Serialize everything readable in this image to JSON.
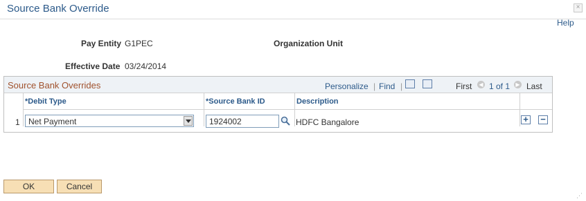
{
  "window": {
    "title": "Source Bank Override",
    "close_glyph": "×"
  },
  "help_link": "Help",
  "header": {
    "pay_entity_label": "Pay Entity",
    "pay_entity_value": "G1PEC",
    "org_unit_label": "Organization Unit",
    "effective_date_label": "Effective Date",
    "effective_date_value": "03/24/2014"
  },
  "grid": {
    "title": "Source Bank Overrides",
    "toolbar": {
      "personalize": "Personalize",
      "separator": "|",
      "find": "Find",
      "first": "First",
      "range": "1 of 1",
      "last": "Last"
    },
    "columns": [
      "*Debit Type",
      "*Source Bank ID",
      "Description"
    ],
    "rows": [
      {
        "num": "1",
        "debit_type": "Net Payment",
        "source_bank_id": "1924002",
        "description": "HDFC Bangalore"
      }
    ],
    "row_actions": {
      "add": "+",
      "delete": "−"
    }
  },
  "buttons": {
    "ok": "OK",
    "cancel": "Cancel"
  },
  "colors": {
    "title": "#2c5a8a",
    "grid_title": "#a0522d",
    "button_bg": "#f7dfb5"
  },
  "icons": [
    "close-icon",
    "view-all-icon",
    "download-icon",
    "previous-icon",
    "next-icon",
    "lookup-icon",
    "add-row-icon",
    "delete-row-icon",
    "resize-grip-icon"
  ]
}
